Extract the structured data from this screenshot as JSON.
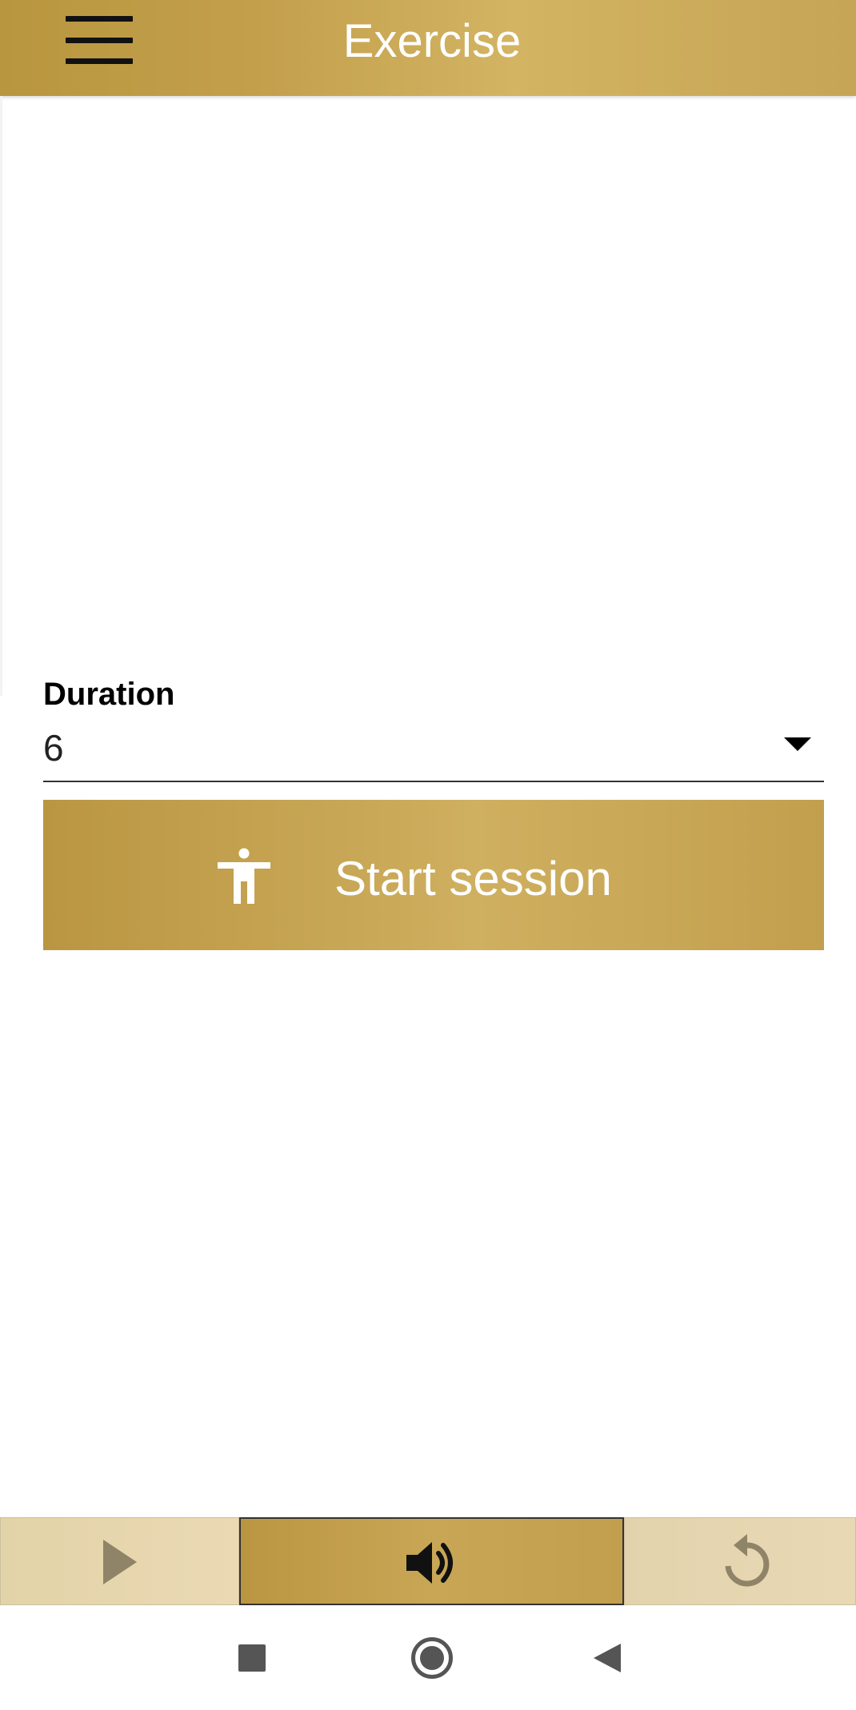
{
  "header": {
    "title": "Exercise",
    "menu_icon": "hamburger-menu-icon"
  },
  "duration": {
    "label": "Duration",
    "value": "6",
    "arrow_icon": "dropdown-arrow-icon"
  },
  "start_button": {
    "label": "Start session",
    "icon": "accessibility-person-icon"
  },
  "controls": {
    "play_icon": "play-icon",
    "sound_icon": "volume-icon",
    "replay_icon": "replay-icon"
  },
  "nav": {
    "recent_icon": "recent-apps-icon",
    "home_icon": "home-icon",
    "back_icon": "back-icon"
  },
  "colors": {
    "accent_gold": "#c6a556",
    "light_gold": "#e6d6ae",
    "text_dark": "#000000",
    "text_light": "#ffffff",
    "nav_gray": "#555555"
  }
}
